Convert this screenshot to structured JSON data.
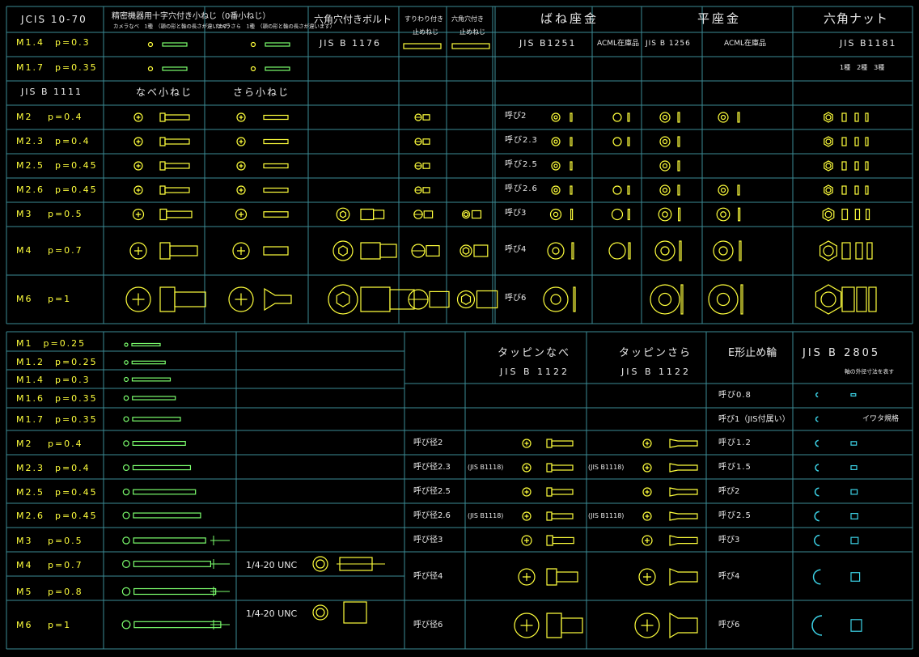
{
  "upper": {
    "title": "JCIS 10-70",
    "h_precision": "精密機器用十字穴付き小ねじ（0番小ねじ）",
    "h_camera_pan": "カメラなべ　1種　（頭の形と軸の長さが違います）",
    "h_camera_sara": "カメラさら　1種　（頭の形と軸の長さが違います）",
    "h_hex_socket": "六角穴付きボルト",
    "h_hex_socket_std": "JIS B 1176",
    "h_grooved_set": "すりわり付き",
    "h_grooved_set2": "止めねじ",
    "h_hex_set": "六角穴付き",
    "h_hex_set2": "止めねじ",
    "h_spring": "ばね座金",
    "h_spring_std": "JIS B1251",
    "h_spring_acml": "ACML在庫品",
    "h_flat": "平座金",
    "h_flat_std": "JIS B 1256",
    "h_flat_acml": "ACML在庫品",
    "h_nut": "六角ナット",
    "h_nut_std": "JIS B1181",
    "h_nut_types": "1種　2種　3種",
    "sub_std": "JIS B 1111",
    "sub_pan": "なべ小ねじ",
    "sub_sara": "さら小ねじ",
    "rows_small": [
      "M1.4　p=0.3",
      "M1.7　p=0.35"
    ],
    "rows_main": [
      {
        "label": "M2　 p=0.4",
        "nominal": "呼び2"
      },
      {
        "label": "M2.3　p=0.4",
        "nominal": "呼び2.3"
      },
      {
        "label": "M2.5　p=0.45",
        "nominal": "呼び2.5"
      },
      {
        "label": "M2.6　p=0.45",
        "nominal": "呼び2.6"
      },
      {
        "label": "M3　 p=0.5",
        "nominal": "呼び3"
      },
      {
        "label": "M4　 p=0.7",
        "nominal": "呼び4"
      },
      {
        "label": "M6　 p=1",
        "nominal": "呼び6"
      }
    ]
  },
  "lower": {
    "rows": [
      "M1　p=0.25",
      "M1.2　p=0.25",
      "M1.4　p=0.3",
      "M1.6　p=0.35",
      "M1.7　p=0.35",
      "M2　 p=0.4",
      "M2.3　p=0.4",
      "M2.5　p=0.45",
      "M2.6　p=0.45",
      "M3　 p=0.5",
      "M4　 p=0.7",
      "M5　 p=0.8",
      "M6　 p=1"
    ],
    "unc_1": "1/4-20 UNC",
    "unc_2": "1/4-20 UNC",
    "tap_pan": "タッピンなべ",
    "tap_pan_std": "JIS B 1122",
    "tap_sara": "タッピンさら",
    "tap_sara_std": "JIS B 1122",
    "tap_rows": [
      "呼び径2",
      "呼び径2.3",
      "呼び径2.5",
      "呼び径2.6",
      "呼び径3",
      "呼び径4",
      "呼び径6"
    ],
    "jis_note": "(JIS B1118)",
    "eclip_title": "E形止め輪",
    "eclip_std": "JIS B 2805",
    "eclip_note": "軸の外径寸法を表す",
    "eclip_rows": [
      "呼び0.8",
      "呼び1（JIS付属い）",
      "呼び1.2",
      "呼び1.5",
      "呼び2",
      "呼び2.5",
      "呼び3",
      "呼び4",
      "呼び6"
    ],
    "eclip_washer_note": "イワタ規格"
  },
  "colors": {
    "grid": "#3c8c96",
    "text": "#e8e8e8",
    "yellow": "#ffff3c",
    "green": "#7cff6e",
    "cyan": "#3cd2e6"
  }
}
